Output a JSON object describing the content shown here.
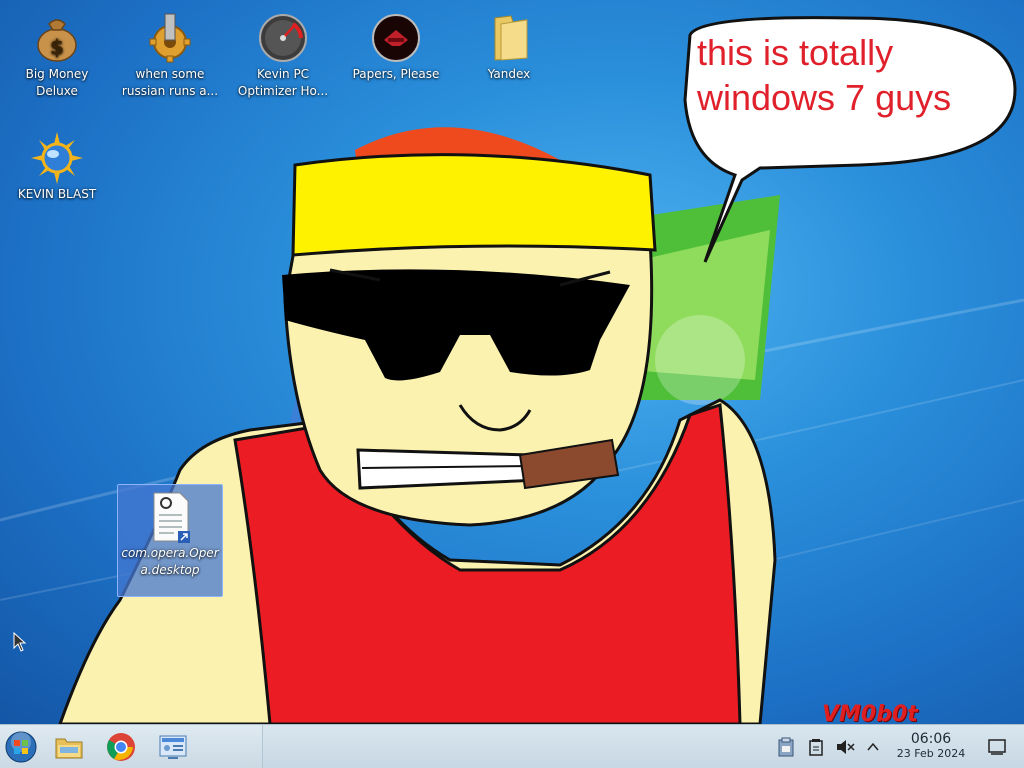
{
  "desktop": {
    "icons": [
      {
        "label": "Big Money Deluxe",
        "icon": "money-bag-icon"
      },
      {
        "label": "when some russian runs a...",
        "icon": "gear-icon"
      },
      {
        "label": "Kevin PC Optimizer Ho...",
        "icon": "speedometer-icon"
      },
      {
        "label": "Papers, Please",
        "icon": "papers-please-icon"
      },
      {
        "label": "Yandex",
        "icon": "folder-icon"
      },
      {
        "label": "KEVIN BLAST",
        "icon": "sun-globe-icon"
      },
      {
        "label": "com.opera.Opera.desktop",
        "icon": "desktop-file-icon"
      }
    ],
    "speech_bubble_text": "this is totally windows 7 guys",
    "watermark": "VM0b0t"
  },
  "taskbar": {
    "launchers": [
      {
        "icon": "start-orb-icon"
      },
      {
        "icon": "file-manager-icon"
      },
      {
        "icon": "chrome-icon"
      },
      {
        "icon": "control-panel-icon"
      }
    ],
    "tray": [
      {
        "icon": "clipboard-icon"
      },
      {
        "icon": "removable-drive-icon"
      },
      {
        "icon": "volume-muted-icon"
      },
      {
        "icon": "chevron-up-icon"
      },
      {
        "icon": "show-desktop-icon"
      }
    ],
    "clock": {
      "time": "06:06",
      "date": "23 Feb 2024"
    }
  }
}
